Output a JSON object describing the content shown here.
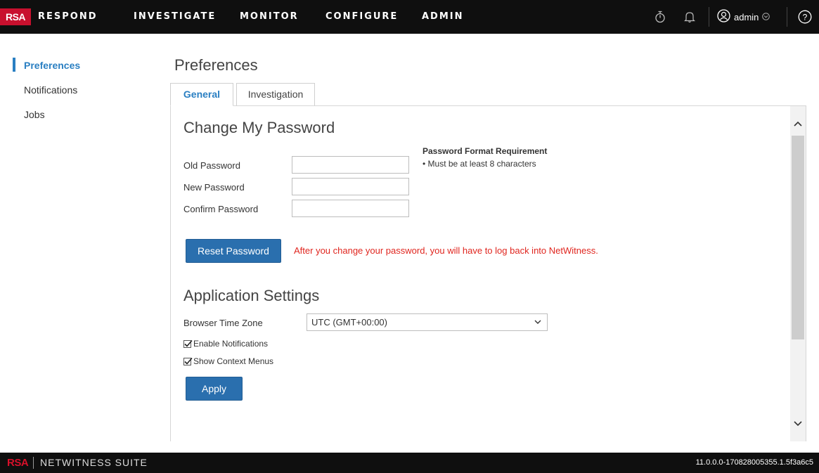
{
  "header": {
    "logo": "RSA",
    "nav": [
      "RESPOND",
      "INVESTIGATE",
      "MONITOR",
      "CONFIGURE",
      "ADMIN"
    ],
    "icons": [
      "stopwatch-icon",
      "bell-icon",
      "user-circle-icon",
      "help-icon"
    ],
    "user": "admin"
  },
  "sidebar": {
    "items": [
      {
        "label": "Preferences",
        "active": true
      },
      {
        "label": "Notifications",
        "active": false
      },
      {
        "label": "Jobs",
        "active": false
      }
    ]
  },
  "main": {
    "title": "Preferences",
    "tabs": [
      {
        "label": "General",
        "active": true
      },
      {
        "label": "Investigation",
        "active": false
      }
    ],
    "password": {
      "section_title": "Change My Password",
      "fields": [
        {
          "label": "Old Password",
          "value": ""
        },
        {
          "label": "New Password",
          "value": ""
        },
        {
          "label": "Confirm Password",
          "value": ""
        }
      ],
      "requirement_title": "Password Format Requirement",
      "requirement_item": "• Must be at least 8 characters",
      "reset_label": "Reset Password",
      "warning": "After you change your password, you will have to log back into NetWitness."
    },
    "app_settings": {
      "section_title": "Application Settings",
      "timezone_label": "Browser Time Zone",
      "timezone_value": "UTC (GMT+00:00)",
      "checkboxes": [
        {
          "label": "Enable Notifications",
          "checked": true
        },
        {
          "label": "Show Context Menus",
          "checked": true
        }
      ],
      "apply_label": "Apply"
    }
  },
  "footer": {
    "logo": "RSA",
    "product": "NETWITNESS SUITE",
    "version": "11.0.0.0-170828005355.1.5f3a6c5"
  },
  "colors": {
    "accent": "#2a7fc2",
    "button": "#2a6fae",
    "warning": "#e0261f",
    "brand_red": "#c8102e",
    "topbar": "#0f0f0f"
  }
}
